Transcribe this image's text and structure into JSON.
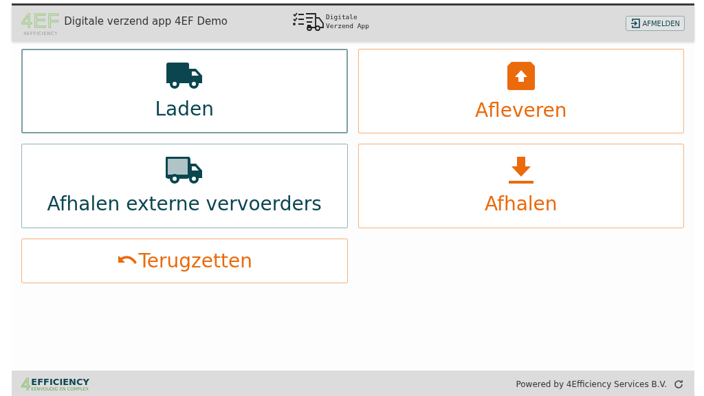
{
  "header": {
    "logo_mark": "4EF",
    "logo_caption": "4EFFICIENCY",
    "title": "Digitale verzend app 4EF Demo",
    "app_badge_lines": [
      "Digitale",
      "Verzend App"
    ],
    "logout_button": "AFMELDEN"
  },
  "tiles": [
    {
      "label": "Laden",
      "kind": "truck",
      "color": "#0b4650",
      "selected": true
    },
    {
      "label": "Afleveren",
      "kind": "box-up",
      "color": "#ea6a0c",
      "selected": false
    },
    {
      "label": "Afhalen externe vervoerders",
      "kind": "truck-light",
      "color": "#0b4650",
      "selected": false
    },
    {
      "label": "Afhalen",
      "kind": "download",
      "color": "#ea6a0c",
      "selected": false
    },
    {
      "label": "Terugzetten",
      "kind": "undo",
      "color": "#ea6a0c",
      "selected": false
    }
  ],
  "footer": {
    "logo_mark": "4",
    "logo_word": "EFFICIENCY",
    "logo_tagline": "EENVOUDIG EN COMPLEX",
    "powered_by": "Powered by 4Efficiency Services B.V."
  }
}
